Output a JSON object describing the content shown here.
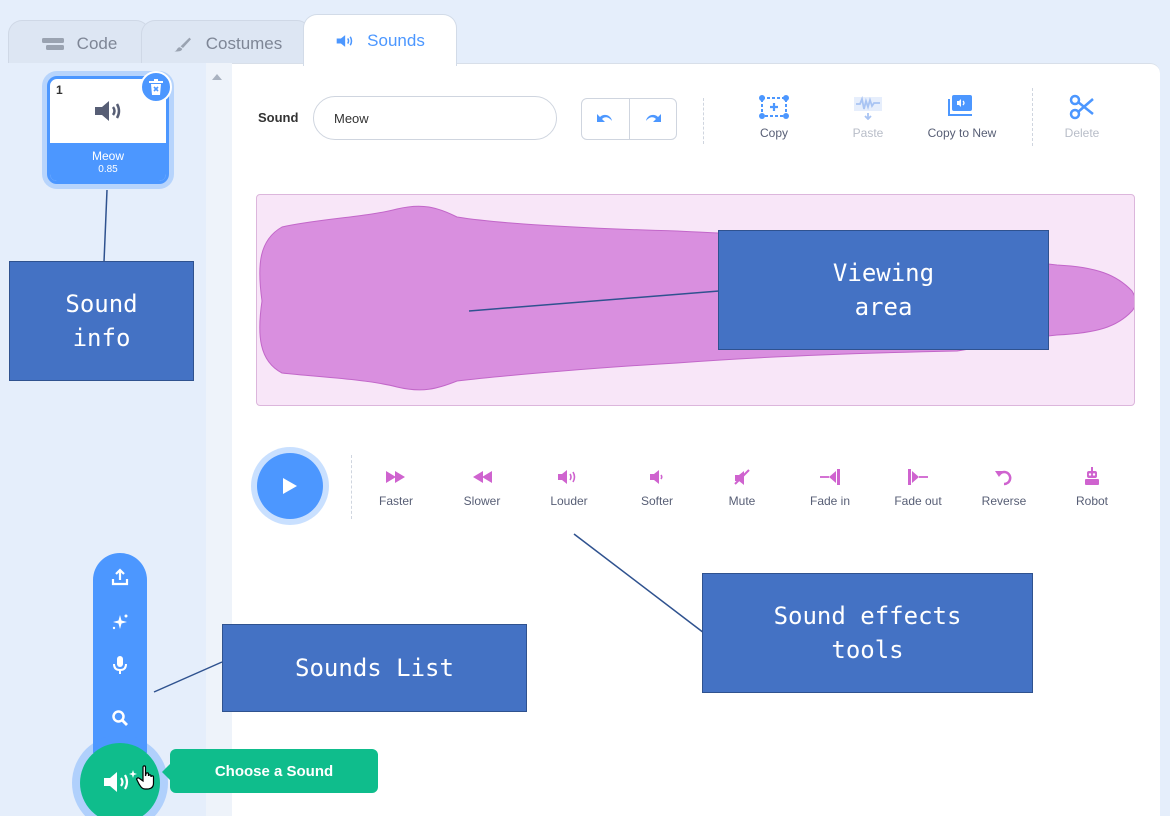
{
  "tabs": [
    {
      "label": "Code",
      "icon": "code-blocks-icon"
    },
    {
      "label": "Costumes",
      "icon": "paintbrush-icon"
    },
    {
      "label": "Sounds",
      "icon": "speaker-icon",
      "active": true
    }
  ],
  "sound_list": {
    "items": [
      {
        "number": "1",
        "name": "Meow",
        "duration": "0.85",
        "icon": "speaker-icon"
      }
    ],
    "delete_icon": "trash-icon"
  },
  "editor": {
    "sound_label": "Sound",
    "sound_name": "Meow",
    "undo_icon": "undo-icon",
    "redo_icon": "redo-icon",
    "tools": [
      {
        "label": "Copy",
        "icon": "copy-selection-icon",
        "enabled": true
      },
      {
        "label": "Paste",
        "icon": "paste-icon",
        "enabled": false
      },
      {
        "label": "Copy to New",
        "icon": "copy-to-new-icon",
        "enabled": true
      },
      {
        "label": "Delete",
        "icon": "scissors-icon",
        "enabled": false
      }
    ],
    "effects": [
      {
        "label": "Faster",
        "icon": "faster-icon"
      },
      {
        "label": "Slower",
        "icon": "slower-icon"
      },
      {
        "label": "Louder",
        "icon": "louder-icon"
      },
      {
        "label": "Softer",
        "icon": "softer-icon"
      },
      {
        "label": "Mute",
        "icon": "mute-icon"
      },
      {
        "label": "Fade in",
        "icon": "fade-in-icon"
      },
      {
        "label": "Fade out",
        "icon": "fade-out-icon"
      },
      {
        "label": "Reverse",
        "icon": "reverse-icon"
      },
      {
        "label": "Robot",
        "icon": "robot-icon"
      }
    ],
    "play_icon": "play-icon"
  },
  "add_sound_menu": {
    "items": [
      {
        "icon": "upload-icon"
      },
      {
        "icon": "surprise-icon"
      },
      {
        "icon": "microphone-icon"
      },
      {
        "icon": "search-icon"
      }
    ],
    "main_icon": "choose-sound-icon",
    "tooltip": "Choose a Sound"
  },
  "annotations": {
    "sound_info": "Sound\ninfo",
    "viewing_area": "Viewing\narea",
    "sound_effects_tools": "Sound effects\ntools",
    "sounds_list": "Sounds List"
  },
  "colors": {
    "accent": "#4c97ff",
    "waveform": "#d98fdf",
    "waveform_bg": "#f8e6f8",
    "effect_icon": "#cf63cf",
    "choose_button": "#0fbd8c",
    "callout": "#4472c4"
  }
}
